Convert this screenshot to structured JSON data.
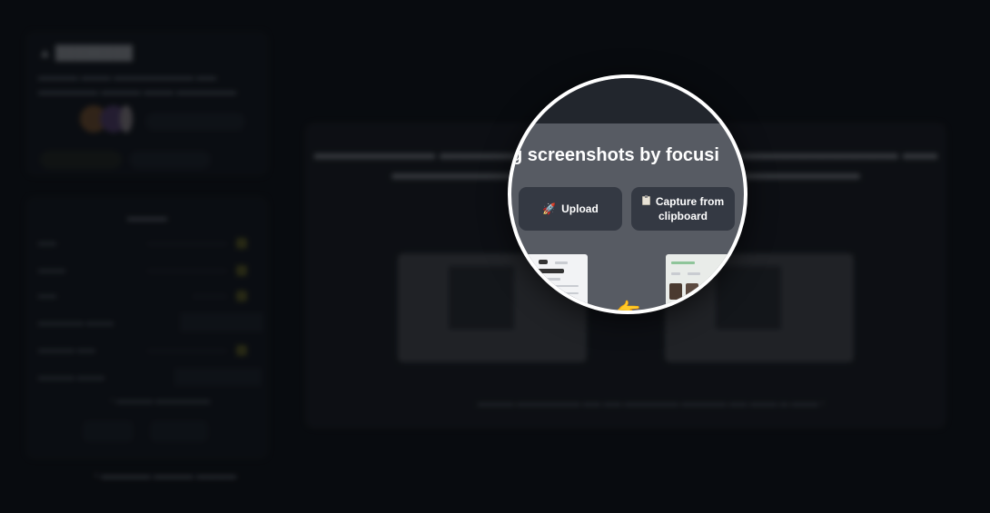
{
  "lens": {
    "heading_fragment": "ning screenshots by focusi",
    "upload_label": "Upload",
    "upload_icon": "rocket-icon",
    "capture_label_line1": "Capture from",
    "capture_label_line2": "clipboard",
    "capture_icon": "clipboard-icon",
    "pointer_icon": "pointing-hand-icon"
  },
  "colors": {
    "page_bg": "#0d1014",
    "lens_bg": "#575b63",
    "lens_border": "#ffffff",
    "button_bg": "#343943",
    "slider_knob": "#8c8a2a"
  }
}
